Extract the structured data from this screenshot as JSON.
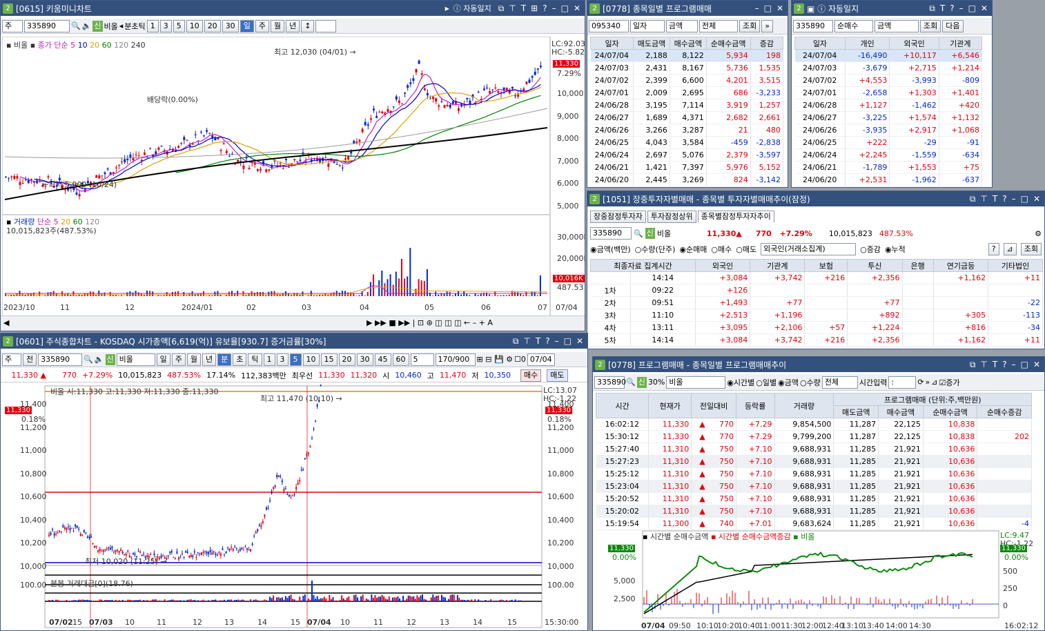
{
  "colors": {
    "title": "#34517d",
    "up": "#e4000f",
    "down": "#0028d0",
    "accent": "#6cb24a"
  },
  "w1": {
    "num": "2",
    "title": "[0615] 키움미니차트",
    "auto": "자동일지",
    "tb": {
      "type": "주",
      "code": "335890",
      "tag": "신",
      "name": "비올",
      "mins": "분초틱",
      "p": [
        "1",
        "3",
        "5",
        "10",
        "20",
        "30"
      ],
      "btns": [
        "일",
        "주",
        "월",
        "년"
      ]
    },
    "legend": {
      "name": "비올",
      "ma": "종가 단순",
      "ma_vals": [
        "5",
        "10",
        "20",
        "60",
        "120",
        "240"
      ]
    },
    "lc": "LC:92.03",
    "hc": "HC:-5.82",
    "price": "11,330",
    "pct": "7.29%",
    "yticks": [
      "10,000",
      "9,000",
      "8,000",
      "7,000",
      "6,000",
      "5,000"
    ],
    "hi": "최고 12,030 (04/01) →",
    "lo": "←최저 5,900 (10/24)",
    "div": "배당락(0.00%)",
    "vol": {
      "legend": "거래량",
      "ma": "단순",
      "ma_vals": [
        "5",
        "20",
        "60",
        "120"
      ],
      "val": "10,015,823주(487.53%)",
      "yticks": [
        "30,000K",
        "20,000K"
      ],
      "tag": "10,016K",
      "tag2": "487.53"
    },
    "xlabels": [
      "2023/10",
      "11",
      "12",
      "2024/01",
      "02",
      "03",
      "04",
      "05",
      "06",
      "07",
      "07/04"
    ]
  },
  "w2": {
    "num": "2",
    "title": "[0778] 종목일별 프로그램매매",
    "code": "095340",
    "opts": [
      "일자",
      "금액",
      "전체"
    ],
    "btn": "조회",
    "cols": [
      "일자",
      "매도금액",
      "매수금액",
      "순매수금액",
      "증감"
    ],
    "rows": [
      [
        "24/07/04",
        "2,188",
        "8,122",
        "5,934",
        "198"
      ],
      [
        "24/07/03",
        "2,431",
        "8,167",
        "5,736",
        "1,535"
      ],
      [
        "24/07/02",
        "2,399",
        "6,600",
        "4,201",
        "3,515"
      ],
      [
        "24/07/01",
        "2,009",
        "2,695",
        "686",
        "-3,233"
      ],
      [
        "24/06/28",
        "3,195",
        "7,114",
        "3,919",
        "1,257"
      ],
      [
        "24/06/27",
        "1,689",
        "4,371",
        "2,682",
        "2,661"
      ],
      [
        "24/06/26",
        "3,266",
        "3,287",
        "21",
        "480"
      ],
      [
        "24/06/25",
        "4,043",
        "3,584",
        "-459",
        "-2,838"
      ],
      [
        "24/06/24",
        "2,697",
        "5,076",
        "2,379",
        "-3,597"
      ],
      [
        "24/06/21",
        "1,421",
        "7,397",
        "5,976",
        "5,152"
      ],
      [
        "24/06/20",
        "2,445",
        "3,269",
        "824",
        "-3,142"
      ]
    ]
  },
  "w3": {
    "num": "2",
    "auto": "자동일지",
    "code": "335890",
    "opts": [
      "순매수",
      "금액"
    ],
    "btn": "조회",
    "btn2": "다음",
    "cols": [
      "일자",
      "개인",
      "외국인",
      "기관계"
    ],
    "rows": [
      [
        "24/07/04",
        "-16,490",
        "+10,117",
        "+6,546"
      ],
      [
        "24/07/03",
        "-3,679",
        "+2,715",
        "+1,214"
      ],
      [
        "24/07/02",
        "+4,553",
        "-3,993",
        "-809"
      ],
      [
        "24/07/01",
        "-2,658",
        "+1,303",
        "+1,401"
      ],
      [
        "24/06/28",
        "+1,127",
        "-1,462",
        "+420"
      ],
      [
        "24/06/27",
        "-3,225",
        "+1,574",
        "+1,132"
      ],
      [
        "24/06/26",
        "-3,935",
        "+2,917",
        "+1,068"
      ],
      [
        "24/06/25",
        "+222",
        "-29",
        "-91"
      ],
      [
        "24/06/24",
        "+2,245",
        "-1,559",
        "-634"
      ],
      [
        "24/06/21",
        "-1,789",
        "+1,553",
        "+75"
      ],
      [
        "24/06/20",
        "+2,531",
        "-1,962",
        "-637"
      ]
    ]
  },
  "w4": {
    "num": "2",
    "title": "[1051] 장중투자자별매매 - 종목별 투자자별매매추이(잠정)",
    "tabs": [
      "장중잠정투자자",
      "투자잠정상위",
      "종목별잠정투자자추이"
    ],
    "code": "335890",
    "tag": "신",
    "name": "비올",
    "price": "11,330▲",
    "chg": "770",
    "pct": "+7.29%",
    "vol": "10,015,823",
    "volpct": "487.53%",
    "radio1": [
      "금액(백만)",
      "수량(단주)"
    ],
    "radio2": [
      "순매매",
      "매수",
      "매도"
    ],
    "sel": "외국인(거래소집계)",
    "radio3": [
      "증감",
      "누적"
    ],
    "btn": "조회",
    "cols": [
      "최종자료 집계시간",
      "외국인",
      "기관계",
      "보험",
      "투신",
      "은행",
      "연기금등",
      "기타법인"
    ],
    "rows": [
      [
        "",
        "14:14",
        "+3,084",
        "+3,742",
        "+216",
        "+2,356",
        "",
        "+1,162",
        "+11"
      ],
      [
        "1차",
        "09:22",
        "+126",
        "",
        "",
        "",
        "",
        "",
        ""
      ],
      [
        "2차",
        "09:51",
        "+1,493",
        "+77",
        "",
        "+77",
        "",
        "",
        "-22"
      ],
      [
        "3차",
        "11:10",
        "+2,513",
        "+1,196",
        "",
        "+892",
        "",
        "+305",
        "-113"
      ],
      [
        "4차",
        "13:11",
        "+3,095",
        "+2,106",
        "+57",
        "+1,224",
        "",
        "+816",
        "-34"
      ],
      [
        "5차",
        "14:14",
        "+3,084",
        "+3,742",
        "+216",
        "+2,356",
        "",
        "+1,162",
        "+11"
      ]
    ]
  },
  "w5": {
    "num": "2",
    "title": "[0601] 주식종합차트 - KOSDAQ 시가총액[6,619(억)] 유보율[930.7] 증거금률[30%]",
    "tb": {
      "type": "주",
      "jeon": "전",
      "code": "335890",
      "tag": "신",
      "name": "비올",
      "periods": [
        "일",
        "주",
        "월",
        "년"
      ],
      "units": [
        "분",
        "초",
        "틱"
      ],
      "p": [
        "1",
        "3",
        "5",
        "10",
        "15",
        "20",
        "30",
        "45",
        "60"
      ],
      "n": "5",
      "count": "170/900",
      "date": "07/04",
      "chk": "0"
    },
    "info": {
      "price": "11,330 ▲",
      "chg": "770",
      "pct": "+7.29%",
      "vol": "10,015,823",
      "volpct": "487.53%",
      "turn": "17.14%",
      "amt": "112,383백만",
      "best": "최우선",
      "bid": "11,330",
      "ask": "11,320",
      "open_l": "시",
      "open": "10,460",
      "high_l": "고",
      "high": "11,470",
      "low_l": "저",
      "low": "10,350",
      "buy": "매수",
      "sell": "매도"
    },
    "legend": "비올 시:11,330 고:11,330 저:11,330 종:11,330",
    "lc": "LC:13.07",
    "hc": "HC:-1.22",
    "price": "11,330",
    "pct": "0.18%",
    "hi": "최고 11,470 (10:10) →",
    "lo": "최저 10,020 (11:25) →",
    "yticks": [
      "11,400",
      "11,200",
      "11,000",
      "10,800",
      "10,600",
      "10,400",
      "10,200",
      "10,000"
    ],
    "sub": {
      "legend": "분봉 거래대금[0](18.76)",
      "yticks": [
        "100.00",
        "100.00"
      ]
    },
    "xlabels": [
      "07/02",
      "15",
      "07/03",
      "10",
      "11",
      "12",
      "13",
      "14",
      "15",
      "07/04",
      "10",
      "11",
      "12",
      "13",
      "14",
      "15",
      "15:30:00"
    ]
  },
  "w6": {
    "num": "2",
    "title": "[0778] 프로그램매매 - 종목일별 프로그램매매추이",
    "code": "335890",
    "tag": "신",
    "pct30": "30%",
    "name": "비올",
    "radio1": [
      "시간별",
      "일별"
    ],
    "radio2": [
      "금액",
      "수량"
    ],
    "sel": "전체",
    "timeinp": "시간입력",
    "chk": "증가",
    "group": "프로그램매매 (단위:주,백만원)",
    "cols": [
      "시간",
      "현재가",
      "전일대비",
      "등락률",
      "거래량",
      "매도금액",
      "매수금액",
      "순매수금액",
      "순매수증감"
    ],
    "rows": [
      [
        "16:02:12",
        "11,330",
        "770",
        "+7.29",
        "9,854,500",
        "11,287",
        "22,125",
        "10,838",
        ""
      ],
      [
        "15:30:12",
        "11,330",
        "770",
        "+7.29",
        "9,799,200",
        "11,287",
        "22,125",
        "10,838",
        "202"
      ],
      [
        "15:27:40",
        "11,310",
        "750",
        "+7.10",
        "9,688,931",
        "11,285",
        "21,921",
        "10,636",
        ""
      ],
      [
        "15:27:23",
        "11,310",
        "750",
        "+7.10",
        "9,688,931",
        "11,285",
        "21,921",
        "10,636",
        ""
      ],
      [
        "15:25:12",
        "11,310",
        "750",
        "+7.10",
        "9,688,931",
        "11,285",
        "21,921",
        "10,636",
        ""
      ],
      [
        "15:23:04",
        "11,310",
        "750",
        "+7.10",
        "9,688,931",
        "11,285",
        "21,921",
        "10,636",
        ""
      ],
      [
        "15:20:52",
        "11,310",
        "750",
        "+7.10",
        "9,688,931",
        "11,285",
        "21,921",
        "10,636",
        ""
      ],
      [
        "15:20:02",
        "11,310",
        "750",
        "+7.10",
        "9,688,931",
        "11,285",
        "21,921",
        "10,636",
        ""
      ],
      [
        "15:19:54",
        "11,300",
        "740",
        "+7.01",
        "9,683,624",
        "11,285",
        "21,921",
        "10,636",
        "-4"
      ]
    ],
    "chart": {
      "l1": "시간별 순매수금액",
      "l2": "시간별 순매수금액증감",
      "l3": "비올",
      "price": "11,330",
      "pct": "0.00%",
      "lc": "LC:9.47",
      "hc": "HC:-1.22",
      "yleft": [
        "5,000",
        "2,500"
      ],
      "yright": [
        "500",
        "250",
        "0"
      ],
      "xlabels": [
        "07/04",
        "09:50",
        "10:10",
        "10:20",
        "10:40",
        "11:00",
        "11:30",
        "12:00",
        "12:40",
        "13:10",
        "13:40",
        "14:00",
        "14:30",
        "16:02:12"
      ]
    }
  }
}
